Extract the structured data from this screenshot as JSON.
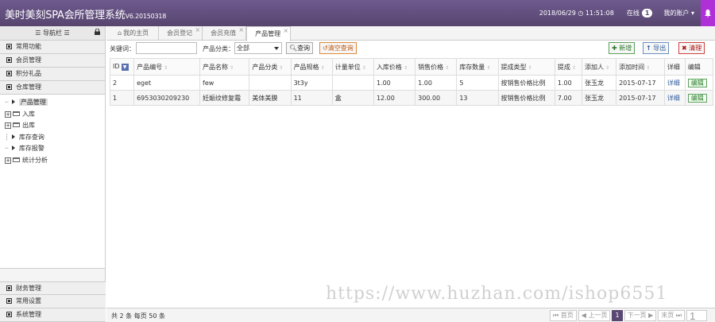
{
  "header": {
    "title": "美时美刻SPA会所管理系统",
    "version": "V6.20150318",
    "datetime": "2018/06/29 ◷ 11:51:08",
    "online_label": "在线",
    "online_count": "1",
    "account_label": "我的账户 ▾",
    "bell_icon": "bell-icon"
  },
  "sidebar": {
    "title": "☰ 导航栏 ☰",
    "top_menus": [
      "常用功能",
      "会员管理",
      "积分礼品",
      "仓库管理"
    ],
    "tree": [
      {
        "kind": "leaf",
        "label": "产品管理",
        "active": true
      },
      {
        "kind": "folder",
        "label": "入库"
      },
      {
        "kind": "folder",
        "label": "出库"
      },
      {
        "kind": "leaf",
        "label": "库存查询"
      },
      {
        "kind": "leaf",
        "label": "库存报警"
      },
      {
        "kind": "folder",
        "label": "统计分析"
      }
    ],
    "bottom_menus": [
      "财务管理",
      "常用设置",
      "系统管理"
    ]
  },
  "tabs": [
    {
      "label": "我的主页",
      "icon": "home-icon",
      "closable": false
    },
    {
      "label": "会员登记",
      "closable": true
    },
    {
      "label": "会员充值",
      "closable": true
    },
    {
      "label": "产品管理",
      "closable": true,
      "active": true
    }
  ],
  "toolbar": {
    "keyword_label": "关键词：",
    "keyword_value": "",
    "category_label": "产品分类：",
    "category_value": "全部",
    "query_label": "查询",
    "clear_query_label": "清空查询",
    "add_label": "新增",
    "export_label": "导出",
    "empty_label": "清理"
  },
  "table": {
    "columns": [
      "ID",
      "产品编号",
      "产品名称",
      "产品分类",
      "产品规格",
      "计量单位",
      "入库价格",
      "销售价格",
      "库存数量",
      "提成类型",
      "提成",
      "添加人",
      "添加时间",
      "详细",
      "编辑"
    ],
    "rows": [
      [
        "2",
        "eget",
        "few",
        "",
        "3t3y",
        "",
        "1.00",
        "1.00",
        "5",
        "按销售价格比例",
        "1.00",
        "张玉龙",
        "2015-07-17",
        "详细",
        "编辑"
      ],
      [
        "1",
        "6953030209230",
        "妊娠纹修复霜",
        "美体美膜",
        "11",
        "盒",
        "12.00",
        "300.00",
        "13",
        "按销售价格比例",
        "7.00",
        "张玉龙",
        "2015-07-17",
        "详细",
        "编辑"
      ]
    ]
  },
  "footer": {
    "info": "共 2 条 每页 50 条",
    "first": "⏮ 首页",
    "prev": "◀ 上一页",
    "current_page": "1",
    "next": "下一页 ▶",
    "last": "末页 ⏭",
    "page_input": "1"
  },
  "watermark": "https://www.huzhan.com/ishop6551",
  "colors": {
    "header_bg": "#5a4872",
    "accent_bell": "#b030d8"
  }
}
